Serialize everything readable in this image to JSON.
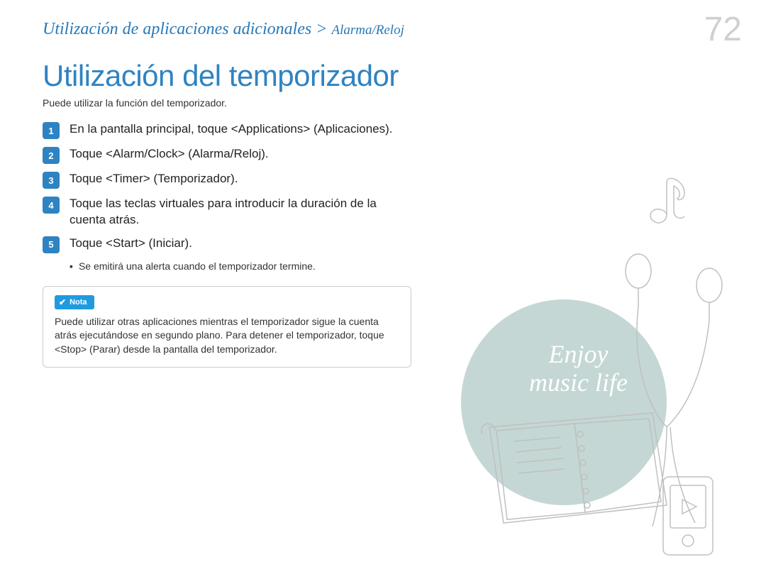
{
  "breadcrumb": {
    "main": "Utilización de aplicaciones adicionales",
    "separator": " > ",
    "sub": "Alarma/Reloj"
  },
  "page_number": "72",
  "title": "Utilización del temporizador",
  "intro": "Puede utilizar la función del temporizador.",
  "steps": [
    {
      "n": "1",
      "text": "En la pantalla principal, toque <Applications> (Aplicaciones)."
    },
    {
      "n": "2",
      "text": "Toque <Alarm/Clock> (Alarma/Reloj)."
    },
    {
      "n": "3",
      "text": "Toque <Timer> (Temporizador)."
    },
    {
      "n": "4",
      "text": "Toque las teclas virtuales para introducir la duración de la cuenta atrás."
    },
    {
      "n": "5",
      "text": "Toque <Start> (Iniciar)."
    }
  ],
  "sub_bullet": "Se emitirá una alerta cuando el temporizador termine.",
  "note": {
    "label": "Nota",
    "text": "Puede utilizar otras aplicaciones mientras el temporizador sigue la cuenta atrás ejecutándose en segundo plano. Para detener el temporizador, toque <Stop> (Parar) desde la pantalla del temporizador."
  },
  "illustration": {
    "tagline_line1": "Enjoy",
    "tagline_line2": "music life"
  }
}
